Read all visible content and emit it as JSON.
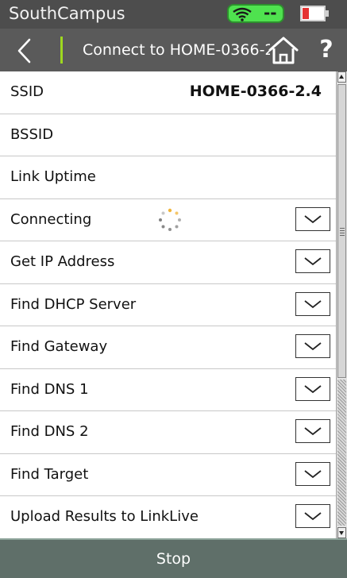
{
  "status_bar": {
    "device_name": "SouthCampus",
    "wifi_icon": "wifi-icon",
    "wifi_text": "--",
    "battery_icon": "battery-low-icon",
    "colors": {
      "wifi_badge": "#4fe24f",
      "battery_low": "#e53232"
    }
  },
  "nav": {
    "back_icon": "chevron-left-icon",
    "title": "Connect to HOME-0366-2.4",
    "home_icon": "home-icon",
    "help_label": "?",
    "accent": "#9ed81f"
  },
  "list": {
    "rows": [
      {
        "label": "SSID",
        "value": "HOME-0366-2.4"
      },
      {
        "label": "BSSID",
        "value": ""
      },
      {
        "label": "Link Uptime",
        "value": ""
      },
      {
        "label": "Connecting",
        "status_icon": "spinner-icon",
        "expand_icon": "chevron-down-icon"
      },
      {
        "label": "Get IP Address",
        "expand_icon": "chevron-down-icon"
      },
      {
        "label": "Find DHCP Server",
        "expand_icon": "chevron-down-icon"
      },
      {
        "label": "Find Gateway",
        "expand_icon": "chevron-down-icon"
      },
      {
        "label": "Find DNS 1",
        "expand_icon": "chevron-down-icon"
      },
      {
        "label": "Find DNS 2",
        "expand_icon": "chevron-down-icon"
      },
      {
        "label": "Find Target",
        "expand_icon": "chevron-down-icon"
      },
      {
        "label": "Upload Results to LinkLive",
        "expand_icon": "chevron-down-icon"
      }
    ]
  },
  "footer": {
    "stop_label": "Stop",
    "color": "#5f6f69"
  }
}
